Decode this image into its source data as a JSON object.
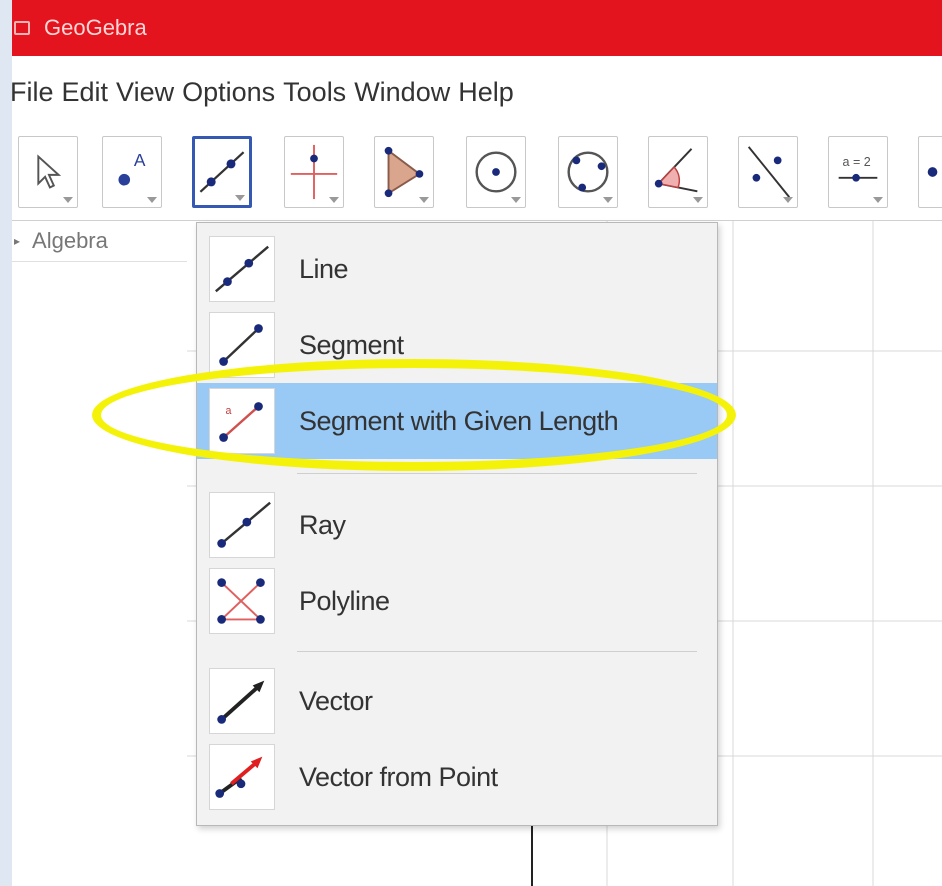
{
  "window": {
    "title": "GeoGebra"
  },
  "menubar": {
    "items": [
      "File",
      "Edit",
      "View",
      "Options",
      "Tools",
      "Window",
      "Help"
    ]
  },
  "toolbar": {
    "tools": [
      {
        "name": "move-tool-icon"
      },
      {
        "name": "point-tool-icon"
      },
      {
        "name": "line-tool-icon",
        "selected": true
      },
      {
        "name": "perpendicular-line-tool-icon"
      },
      {
        "name": "polygon-tool-icon"
      },
      {
        "name": "circle-tool-icon"
      },
      {
        "name": "circle-through-points-tool-icon"
      },
      {
        "name": "angle-tool-icon"
      },
      {
        "name": "reflect-tool-icon"
      },
      {
        "name": "slider-tool-icon",
        "text": "a = 2"
      }
    ]
  },
  "algebra": {
    "title": "Algebra"
  },
  "dropdown": {
    "items": [
      {
        "label": "Line",
        "icon": "line-icon"
      },
      {
        "label": "Segment",
        "icon": "segment-icon"
      },
      {
        "label": "Segment with Given Length",
        "icon": "segment-with-given-length-icon",
        "highlighted": true
      },
      {
        "label": "Ray",
        "icon": "ray-icon"
      },
      {
        "label": "Polyline",
        "icon": "polyline-icon"
      },
      {
        "label": "Vector",
        "icon": "vector-icon"
      },
      {
        "label": "Vector from Point",
        "icon": "vector-from-point-icon"
      }
    ]
  },
  "colors": {
    "titlebar": "#e4141e",
    "highlight_row": "#99c9f5",
    "annotation_ellipse": "#f5f20a",
    "selected_tool_border": "#3559b3"
  }
}
